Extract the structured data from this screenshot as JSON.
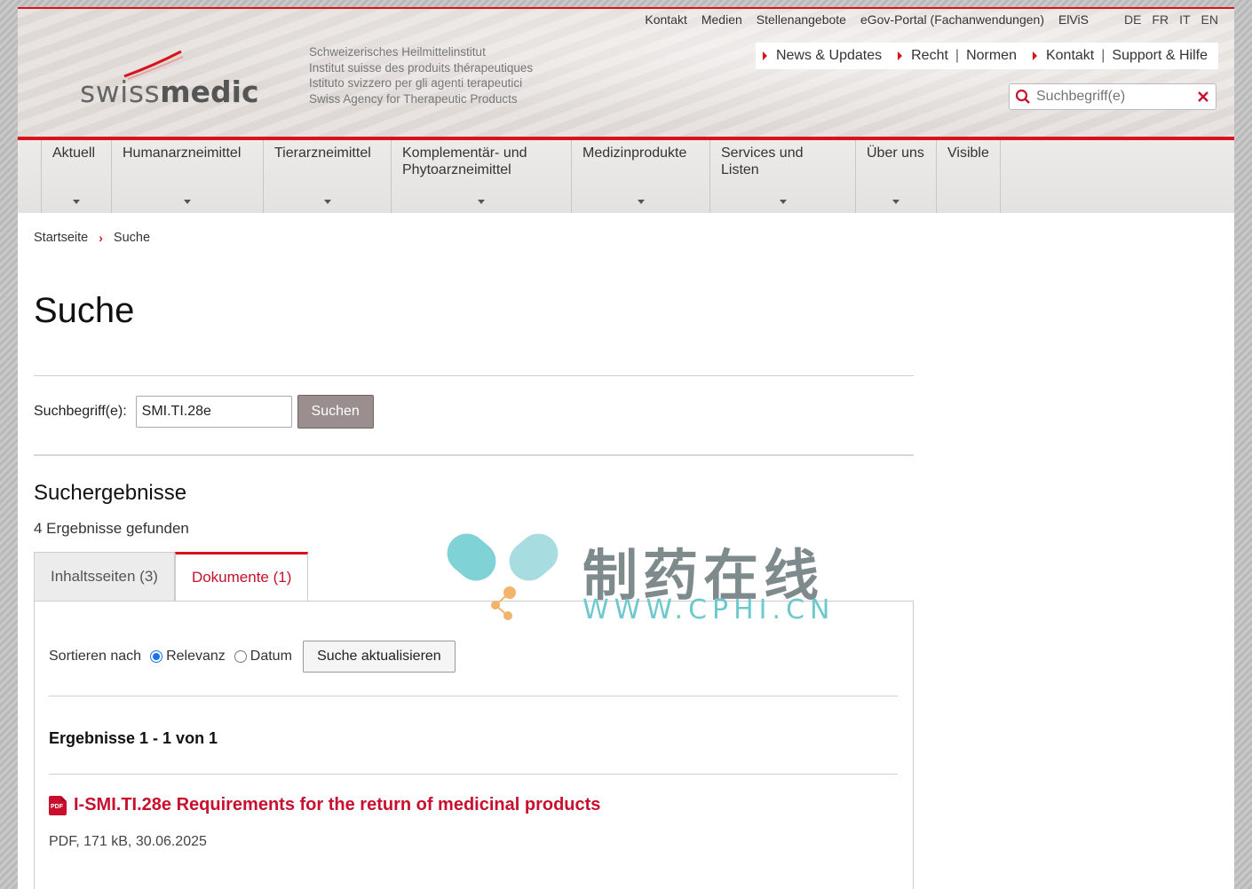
{
  "topnav": {
    "items": [
      "Kontakt",
      "Medien",
      "Stellenangebote",
      "eGov-Portal (Fachanwendungen)",
      "ElViS"
    ],
    "langs": [
      "DE",
      "FR",
      "IT",
      "EN"
    ]
  },
  "logo": {
    "light": "swiss",
    "bold": "medic"
  },
  "institute": [
    "Schweizerisches Heilmittelinstitut",
    "Institut suisse des produits thérapeutiques",
    "Istituto svizzero per gli agenti terapeutici",
    "Swiss Agency for Therapeutic Products"
  ],
  "quicklinks": {
    "news": "News & Updates",
    "recht": "Recht",
    "normen": "Normen",
    "kontakt": "Kontakt",
    "support": "Support & Hilfe",
    "sep": "|"
  },
  "header_search": {
    "placeholder": "Suchbegriff(e)"
  },
  "mainnav": [
    {
      "line1": "Aktuell",
      "line2": ""
    },
    {
      "line1": "Humanarzneimittel",
      "line2": ""
    },
    {
      "line1": "Tierarzneimittel",
      "line2": ""
    },
    {
      "line1": "Komplementär- und",
      "line2": "Phytoarzneimittel"
    },
    {
      "line1": "Medizinprodukte",
      "line2": ""
    },
    {
      "line1": "Services und Listen",
      "line2": ""
    },
    {
      "line1": "Über uns",
      "line2": ""
    },
    {
      "line1": "Visible",
      "line2": ""
    }
  ],
  "breadcrumb": {
    "home": "Startseite",
    "sep": "›",
    "current": "Suche"
  },
  "page_title": "Suche",
  "search_form": {
    "label": "Suchbegriff(e):",
    "value": "SMI.TI.28e",
    "button": "Suchen"
  },
  "results": {
    "heading": "Suchergebnisse",
    "count": "4 Ergebnisse gefunden",
    "tabs": {
      "content": "Inhaltsseiten (3)",
      "documents": "Dokumente (1)"
    },
    "sort": {
      "label": "Sortieren nach",
      "relevance": "Relevanz",
      "date": "Datum",
      "update_button": "Suche aktualisieren",
      "selected": "Relevanz"
    },
    "range": "Ergebnisse  1 - 1  von  1",
    "documents": [
      {
        "icon": "pdf-icon",
        "title": "I-SMI.TI.28e Requirements for the return of medicinal products",
        "meta": "PDF, 171 kB, 30.06.2025"
      }
    ]
  },
  "watermark": {
    "text": "制药在线",
    "url": "WWW.CPHI.CN"
  },
  "colors": {
    "accent": "#d9131b",
    "link": "#c8102e",
    "button": "#9b8e8e"
  }
}
